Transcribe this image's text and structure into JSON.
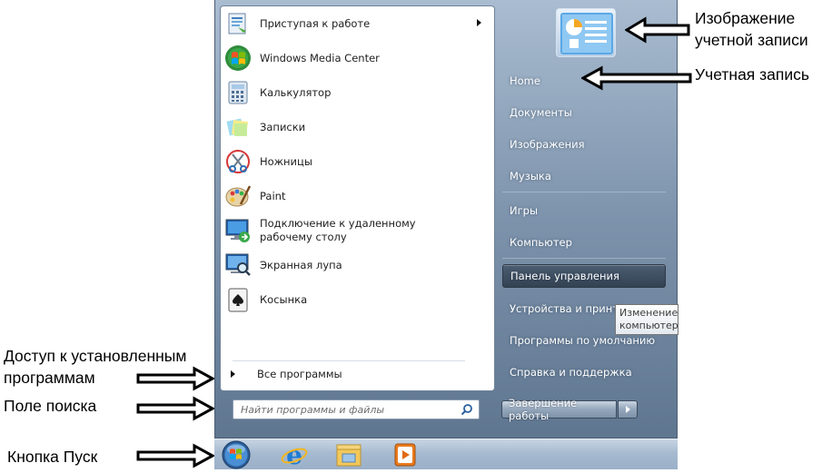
{
  "left_pane": {
    "items": [
      {
        "label": "Приступая к работе",
        "icon": "getting-started-icon",
        "has_submenu": true
      },
      {
        "label": "Windows Media Center",
        "icon": "media-center-icon"
      },
      {
        "label": "Калькулятор",
        "icon": "calculator-icon"
      },
      {
        "label": "Записки",
        "icon": "sticky-notes-icon"
      },
      {
        "label": "Ножницы",
        "icon": "scissors-icon"
      },
      {
        "label": "Paint",
        "icon": "paint-palette-icon"
      },
      {
        "label": "Подключение к удаленному рабочему столу",
        "icon": "remote-desktop-icon"
      },
      {
        "label": "Экранная лупа",
        "icon": "magnifier-icon"
      },
      {
        "label": "Косынка",
        "icon": "solitaire-icon"
      }
    ],
    "all_programs_label": "Все программы",
    "search_placeholder": "Найти программы и файлы"
  },
  "right_pane": {
    "items": [
      {
        "label": "Home"
      },
      {
        "label": "Документы"
      },
      {
        "label": "Изображения"
      },
      {
        "label": "Музыка"
      },
      {
        "label": "Игры"
      },
      {
        "label": "Компьютер"
      },
      {
        "label": "Панель управления",
        "highlighted": true
      },
      {
        "label": "Устройства и принте"
      },
      {
        "label": "Программы по умолчанию"
      },
      {
        "label": "Справка и поддержка"
      }
    ],
    "shutdown_label": "Завершение работы",
    "tooltip_lines": [
      "Изменение",
      "компьютер"
    ]
  },
  "taskbar": {
    "apps": [
      "start-orb-icon",
      "internet-explorer-icon",
      "windows-explorer-icon",
      "media-player-icon"
    ]
  },
  "annotations": {
    "account_picture": [
      "Изображение",
      "учетной записи"
    ],
    "account": "Учетная запись",
    "all_programs": [
      "Доступ к установленным",
      "программам"
    ],
    "search": "Поле поиска",
    "start_button": "Кнопка Пуск"
  },
  "colors": {
    "menu_gradient_top": "#a9bcd0",
    "menu_gradient_bottom": "#5f7690",
    "left_pane_bg": "#ffffff",
    "taskbar": "#a6bad0"
  }
}
